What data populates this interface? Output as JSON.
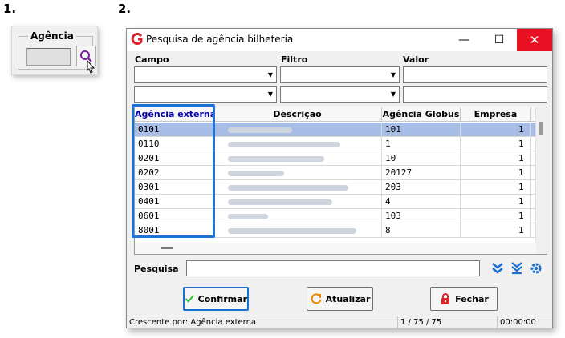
{
  "steps": {
    "one": "1.",
    "two": "2."
  },
  "agency_panel": {
    "label": "Agência",
    "field_value": ""
  },
  "dialog": {
    "title": "Pesquisa de agência bilheteria",
    "controls": {
      "minimize": "—",
      "maximize": "☐",
      "close": "✕"
    },
    "filter_labels": {
      "field": "Campo",
      "filter": "Filtro",
      "value": "Valor"
    },
    "filter_rows": [
      {
        "field": "",
        "filter": "",
        "value": ""
      },
      {
        "field": "",
        "filter": "",
        "value": ""
      }
    ],
    "columns": [
      "Agência externa",
      "Descrição",
      "Agência Globus",
      "Empresa"
    ],
    "rows": [
      {
        "ext": "0101",
        "globus": "101",
        "empresa": "1",
        "selected": true
      },
      {
        "ext": "0110",
        "globus": "1",
        "empresa": "1",
        "selected": false
      },
      {
        "ext": "0201",
        "globus": "10",
        "empresa": "1",
        "selected": false
      },
      {
        "ext": "0202",
        "globus": "20127",
        "empresa": "1",
        "selected": false
      },
      {
        "ext": "0301",
        "globus": "203",
        "empresa": "1",
        "selected": false
      },
      {
        "ext": "0401",
        "globus": "4",
        "empresa": "1",
        "selected": false
      },
      {
        "ext": "0601",
        "globus": "103",
        "empresa": "1",
        "selected": false
      },
      {
        "ext": "8001",
        "globus": "8",
        "empresa": "1",
        "selected": false
      }
    ],
    "search": {
      "label": "Pesquisa",
      "value": ""
    },
    "buttons": {
      "confirm": "Confirmar",
      "refresh": "Atualizar",
      "close": "Fechar"
    },
    "status": {
      "sort": "Crescente por: Agência externa",
      "count": "1 / 75 / 75",
      "time": "00:00:00"
    },
    "colors": {
      "highlight": "#1c73d6",
      "selected_row": "#a8bde6",
      "close_button": "#e81123",
      "header_first_col": "#0000a8"
    }
  }
}
